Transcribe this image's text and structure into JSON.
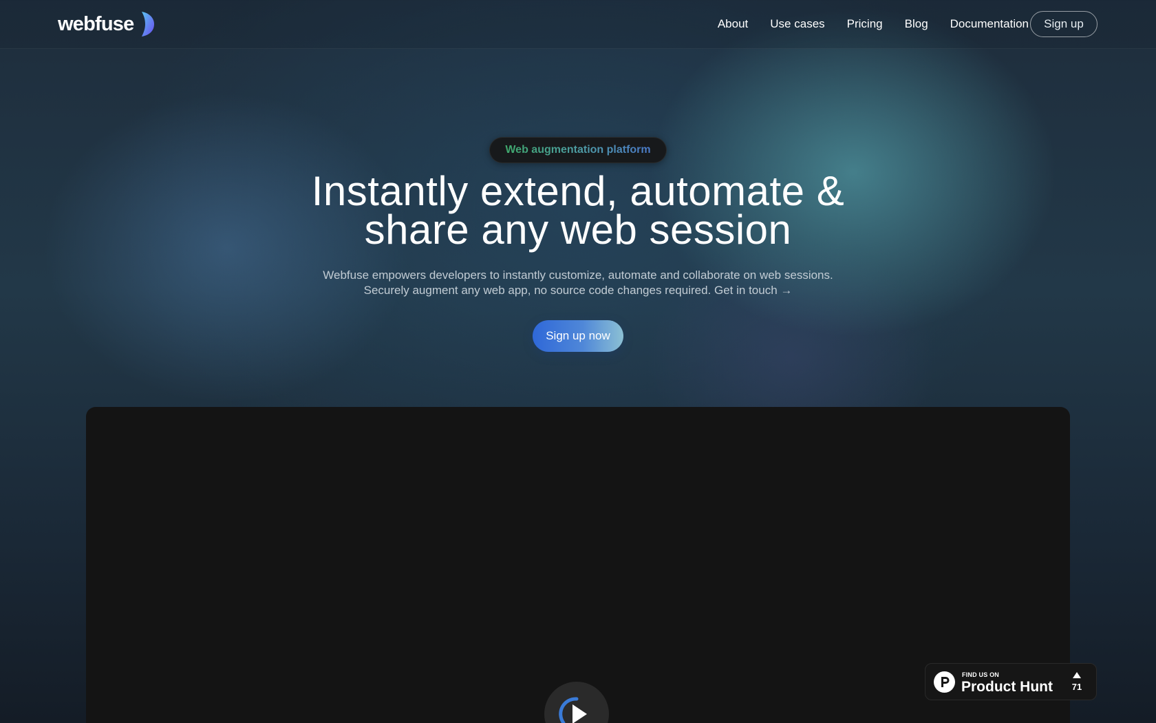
{
  "header": {
    "logo_text": "webfuse",
    "nav": [
      "About",
      "Use cases",
      "Pricing",
      "Blog",
      "Documentation"
    ],
    "signup_label": "Sign up"
  },
  "hero": {
    "badge": "Web augmentation platform",
    "headline_line1": "Instantly extend, automate &",
    "headline_line2": "share any web session",
    "subtext_line1": "Webfuse empowers developers to instantly customize, automate and collaborate on web sessions.",
    "subtext_line2": "Securely augment any web app, no source code changes required.",
    "contact_link": "Get in touch →",
    "cta_label": "Sign up now"
  },
  "video": {
    "play_icon": "play-icon"
  },
  "product_hunt": {
    "small_label": "FIND US ON",
    "big_label": "Product Hunt",
    "upvotes": "71"
  }
}
